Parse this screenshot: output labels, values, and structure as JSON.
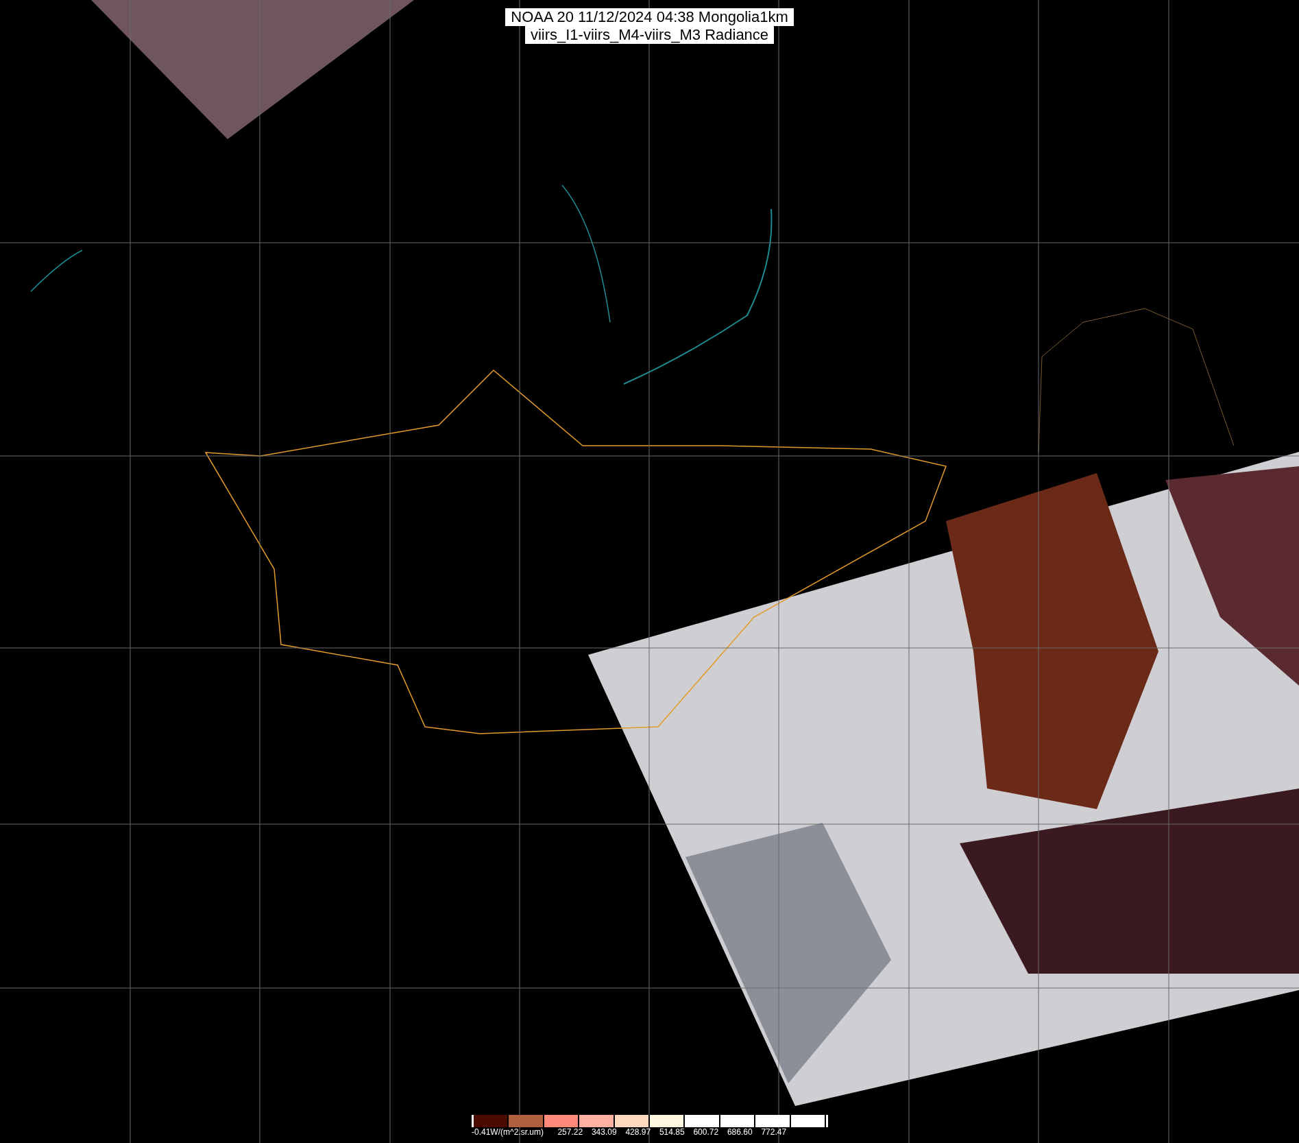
{
  "title": {
    "lines": [
      "NOAA 20 11/12/2024 04:38 Mongolia1km",
      "viirs_I1-viirs_M4-viirs_M3 Radiance"
    ]
  },
  "colorbar": {
    "unit_label": "-0.41W/(m^2.sr.um)",
    "tick_labels": [
      "257.22",
      "343.09",
      "428.97",
      "514.85",
      "600.72",
      "686.60",
      "772.47"
    ]
  }
}
